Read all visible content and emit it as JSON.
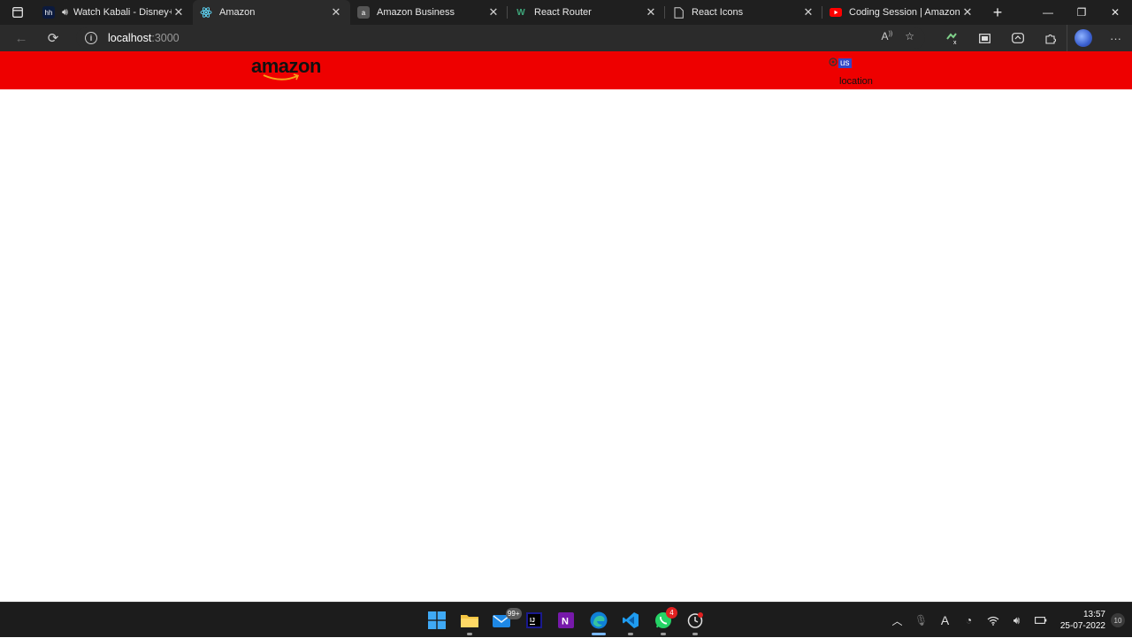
{
  "browser": {
    "tabs": [
      {
        "title": "Watch Kabali - Disney+ Hotstar",
        "icon": "hotstar-icon",
        "audio": true,
        "active": false
      },
      {
        "title": "Amazon",
        "icon": "react-icon",
        "active": true
      },
      {
        "title": "Amazon Business",
        "icon": "amazon-a-icon",
        "active": false
      },
      {
        "title": "React Router",
        "icon": "react-router-icon",
        "active": false
      },
      {
        "title": "React Icons",
        "icon": "page-icon",
        "active": false
      },
      {
        "title": "Coding Session | Amazon Clone",
        "icon": "youtube-icon",
        "active": false
      }
    ],
    "address": {
      "host": "localhost",
      "port": ":3000"
    },
    "accent_red": "#ee0000"
  },
  "site": {
    "logo_text": "amazon",
    "location": {
      "top_text": "us",
      "bottom_text": "location"
    }
  },
  "taskbar": {
    "badges": {
      "mail": "99+",
      "whatsapp": "4"
    },
    "clock": {
      "time": "13:57",
      "date": "25-07-2022"
    },
    "notifications": "10"
  }
}
